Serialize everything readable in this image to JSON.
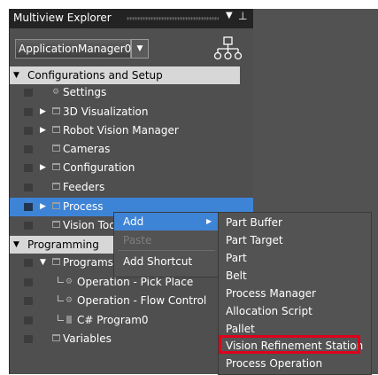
{
  "explorer": {
    "title": "Multiview Explorer",
    "pin_glyph": "▾ 📌",
    "app_select": {
      "value": "ApplicationManager0"
    }
  },
  "sections": {
    "config": "Configurations and Setup",
    "programming": "Programming"
  },
  "config_items": [
    {
      "label": "Settings"
    },
    {
      "label": "3D Visualization"
    },
    {
      "label": "Robot Vision Manager"
    },
    {
      "label": "Cameras"
    },
    {
      "label": "Configuration"
    },
    {
      "label": "Feeders"
    },
    {
      "label": "Process"
    },
    {
      "label": "Vision Tools"
    }
  ],
  "programming_items": [
    {
      "label": "Programs"
    },
    {
      "label": "Operation - Pick Place"
    },
    {
      "label": "Operation - Flow Control"
    },
    {
      "label": "C# Program0"
    },
    {
      "label": "Variables"
    }
  ],
  "context_menu": {
    "add": "Add",
    "paste": "Paste",
    "add_shortcut": "Add Shortcut"
  },
  "add_submenu": [
    "Part Buffer",
    "Part Target",
    "Part",
    "Belt",
    "Process Manager",
    "Allocation Script",
    "Pallet",
    "Vision Refinement Station",
    "Process Operation"
  ],
  "highlighted_item": "Vision Refinement Station",
  "colors": {
    "selection": "#3e84d6",
    "highlight_box": "#e0001a",
    "panel": "#4f4f4f"
  }
}
